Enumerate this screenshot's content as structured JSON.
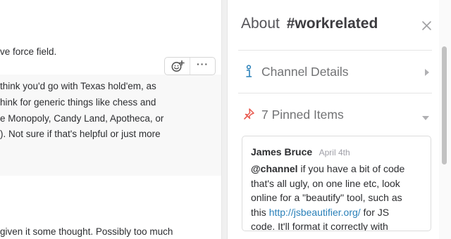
{
  "messages": {
    "line_top": "ve force field.",
    "hovered_lines": [
      "think you'd go with Texas hold'em, as",
      "hink for generic things like chess and",
      "e Monopoly, Candy Land, Apotheca, or",
      "). Not sure if that's helpful or just more"
    ],
    "line_bottom": "given it some thought. Possibly too much",
    "actions": {
      "emoji_icon": "add-reaction-icon",
      "more_label": "···"
    }
  },
  "flexpane": {
    "title_prefix": "About",
    "channel_name": "#workrelated",
    "close_icon": "close-icon",
    "sections": {
      "details": {
        "label": "Channel Details",
        "icon": "info-icon",
        "caret": "chevron-right-icon"
      },
      "pinned": {
        "label": "7 Pinned Items",
        "icon": "pin-icon",
        "caret": "chevron-down-icon"
      }
    },
    "pinned_item": {
      "author": "James Bruce",
      "date": "April 4th",
      "mention": "@channel",
      "line1_rest": " if you have a bit of code",
      "line2": "that's all ugly, on one line etc, look",
      "line3": "online for a \"beautify\" tool, such as",
      "line4_pre": "this ",
      "link": "http://jsbeautifier.org/",
      "line4_post": " for JS",
      "line5": "code. It'll format it correctly with"
    }
  },
  "colors": {
    "link": "#2a80b9",
    "info_icon": "#2a80b9",
    "pin_icon": "#e8594e"
  }
}
